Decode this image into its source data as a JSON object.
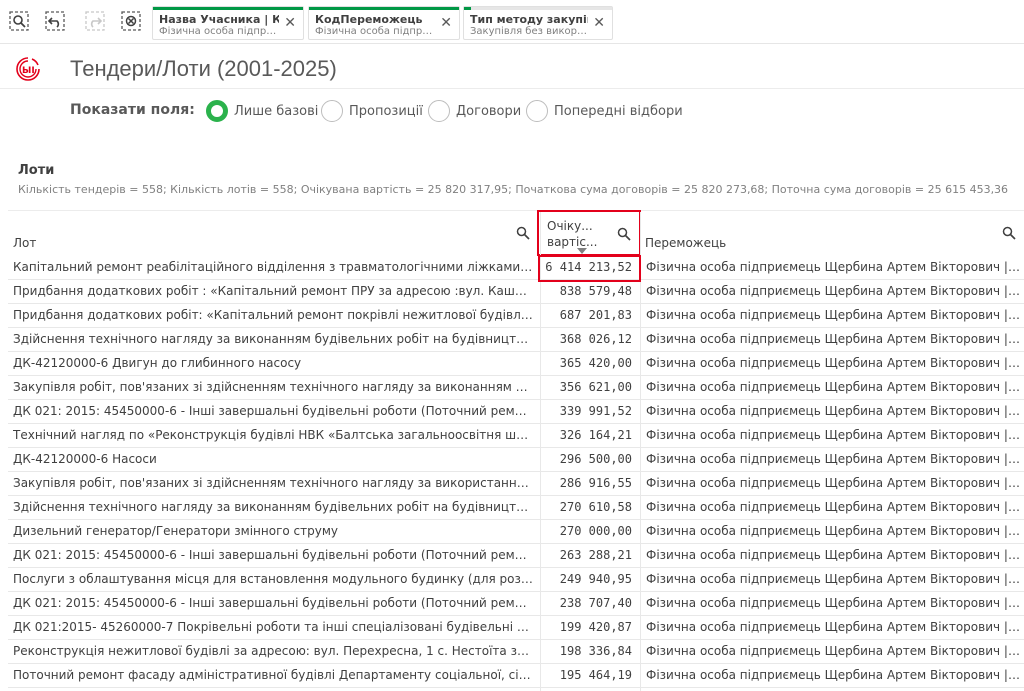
{
  "selections": [
    {
      "field": "Назва Учасника | Ко...",
      "value": "Фізична особа підприє...",
      "fill": 1.0
    },
    {
      "field": "КодПереможець",
      "value": "Фізична особа підприє...",
      "fill": 1.0
    },
    {
      "field": "Тип методу закупівлі",
      "value": "Закупівля без викорис...",
      "fill": 0.05
    }
  ],
  "page": {
    "title": "Тендери/Лоти (2001-2025)"
  },
  "fields": {
    "label": "Показати поля:",
    "options": [
      "Лише базові",
      "Пропозиції",
      "Договори",
      "Попередні відбори"
    ],
    "selected": "Лише базові"
  },
  "table": {
    "title": "Лоти",
    "summary": "Кількість тендерів = 558; Кількість лотів = 558; Очікувана вартість = 25 820 317,95; Початкова сума договорів = 25 820 273,68; Поточна сума договорів = 25 615 453,36",
    "columns": {
      "lot": "Лот",
      "value_line1": "Очіку...",
      "value_line2": "вартіс...",
      "winner": "Переможець"
    },
    "rows": [
      {
        "lot": "Капітальний ремонт реабілітаційного відділення з травматологічними ліжками К...",
        "value": "6 414 213,52",
        "winner": "Фізична особа підприємець Щербина Артем Вікторович | ..."
      },
      {
        "lot": "Придбання додаткових робіт : «Капітальний ремонт ПРУ за адресою :вул. Каштан...",
        "value": "838 579,48",
        "winner": "Фізична особа підприємець Щербина Артем Вікторович | ..."
      },
      {
        "lot": "Придбання додаткових робіт: «Капітальний ремонт покрівлі нежитлової будівлі К...",
        "value": "687 201,83",
        "winner": "Фізична особа підприємець Щербина Артем Вікторович | ..."
      },
      {
        "lot": "Здійснення технічного нагляду за виконанням будівельних робіт на будівництві о...",
        "value": "368 026,12",
        "winner": "Фізична особа підприємець Щербина Артем Вікторович | ..."
      },
      {
        "lot": "ДК-42120000-6 Двигун до глибинного насосу",
        "value": "365 420,00",
        "winner": "Фізична особа підприємець Щербина Артем Вікторович | ..."
      },
      {
        "lot": "Закупівля робіт, пов'язаних зі здійсненням технічного нагляду за виконанням буді...",
        "value": "356 621,00",
        "winner": "Фізична особа підприємець Щербина Артем Вікторович | ..."
      },
      {
        "lot": "ДК 021: 2015: 45450000-6 - Інші завершальні будівельні роботи (Поточний ремо...",
        "value": "339 991,52",
        "winner": "Фізична особа підприємець Щербина Артем Вікторович | ..."
      },
      {
        "lot": "Технічний нагляд по «Реконструкція будівлі НВК «Балтська загальноосвітня школ...",
        "value": "326 164,21",
        "winner": "Фізична особа підприємець Щербина Артем Вікторович | ..."
      },
      {
        "lot": "ДК-42120000-6 Насоси",
        "value": "296 500,00",
        "winner": "Фізична особа підприємець Щербина Артем Вікторович | ..."
      },
      {
        "lot": "Закупівля робіт, пов'язаних зі здійсненням технічного нагляду за використанням ...",
        "value": "286 916,55",
        "winner": "Фізична особа підприємець Щербина Артем Вікторович | ..."
      },
      {
        "lot": "Здійснення технічного нагляду за виконанням будівельних робіт на будівництві о...",
        "value": "270 610,58",
        "winner": "Фізична особа підприємець Щербина Артем Вікторович | ..."
      },
      {
        "lot": "Дизельний генератор/Генератори змінного струму",
        "value": "270 000,00",
        "winner": "Фізична особа підприємець Щербина Артем Вікторович | ..."
      },
      {
        "lot": "ДК 021: 2015: 45450000-6 - Інші завершальні будівельні роботи (Поточний ремо...",
        "value": "263 288,21",
        "winner": "Фізична особа підприємець Щербина Артем Вікторович | ..."
      },
      {
        "lot": "Послуги з облаштування місця для встановлення модульного будинку (для розмі...",
        "value": "249 940,95",
        "winner": "Фізична особа підприємець Щербина Артем Вікторович | ..."
      },
      {
        "lot": "ДК 021: 2015: 45450000-6 - Інші завершальні будівельні роботи (Поточний ремо...",
        "value": "238 707,40",
        "winner": "Фізична особа підприємець Щербина Артем Вікторович | ..."
      },
      {
        "lot": "ДК 021:2015- 45260000-7 Покрівельні роботи та інші спеціалізовані будівельні р...",
        "value": "199 420,87",
        "winner": "Фізична особа підприємець Щербина Артем Вікторович | ..."
      },
      {
        "lot": "Реконструкція нежитлової будівлі за адресою: вул. Перехресна, 1 с. Нестоїта задл...",
        "value": "198 336,84",
        "winner": "Фізична особа підприємець Щербина Артем Вікторович | ..."
      },
      {
        "lot": "Поточний ремонт фасаду адміністративної будівлі Департаменту соціальної, сіме...",
        "value": "195 464,19",
        "winner": "Фізична особа підприємець Щербина Артем Вікторович | ..."
      }
    ]
  },
  "colors": {
    "accent_green": "#009845",
    "radio_green": "#2bb24c",
    "highlight_red": "#e3001b",
    "logo_red": "#e3001b"
  },
  "icons": {
    "tool1": "smart-search-icon",
    "tool2": "step-back-icon",
    "tool3": "step-forward-icon",
    "tool4": "clear-selections-icon",
    "logo": "qlik-logo-icon"
  }
}
